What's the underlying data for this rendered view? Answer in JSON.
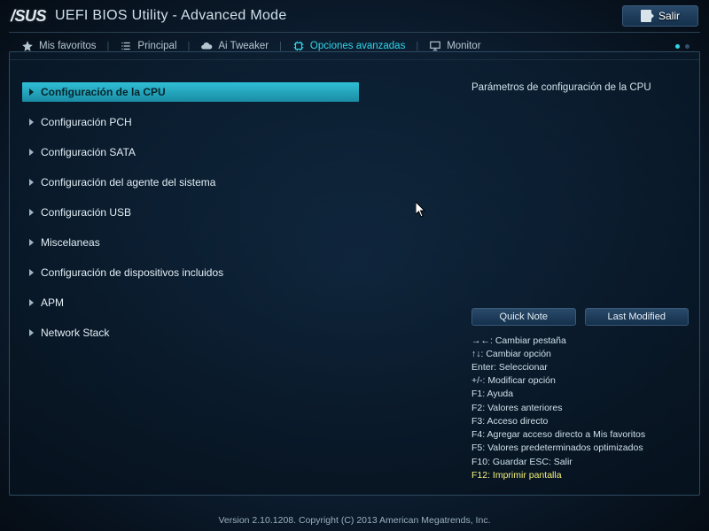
{
  "header": {
    "brand": "/SUS",
    "title": "UEFI BIOS Utility - Advanced Mode",
    "exit_label": "Salir"
  },
  "nav": {
    "items": [
      {
        "label": "Mis favoritos",
        "icon": "star-icon"
      },
      {
        "label": "Principal",
        "icon": "list-icon"
      },
      {
        "label": "Ai Tweaker",
        "icon": "cloud-icon"
      },
      {
        "label": "Opciones avanzadas",
        "icon": "chip-icon",
        "active": true
      },
      {
        "label": "Monitor",
        "icon": "monitor-icon"
      }
    ],
    "page_current": 1,
    "page_total": 2
  },
  "menu": {
    "items": [
      {
        "label": "Configuración de la CPU",
        "selected": true
      },
      {
        "label": "Configuración PCH"
      },
      {
        "label": "Configuración SATA"
      },
      {
        "label": "Configuración del agente del sistema"
      },
      {
        "label": "Configuración USB"
      },
      {
        "label": "Miscelaneas"
      },
      {
        "label": "Configuración de dispositivos incluidos"
      },
      {
        "label": "APM"
      },
      {
        "label": "Network Stack"
      }
    ]
  },
  "info": {
    "title": "Parámetros de configuración de la CPU",
    "quick_note_label": "Quick Note",
    "last_modified_label": "Last Modified"
  },
  "help": {
    "lines": [
      "→←: Cambiar pestaña",
      "↑↓: Cambiar opción",
      "Enter: Seleccionar",
      "+/-: Modificar opción",
      "F1: Ayuda",
      "F2: Valores anteriores",
      "F3: Acceso directo",
      "F4: Agregar acceso directo a Mis favoritos",
      "F5: Valores predeterminados optimizados",
      "F10: Guardar  ESC: Salir"
    ],
    "highlight": "F12: Imprimir pantalla"
  },
  "footer": {
    "text": "Version 2.10.1208. Copyright (C) 2013 American Megatrends, Inc."
  }
}
